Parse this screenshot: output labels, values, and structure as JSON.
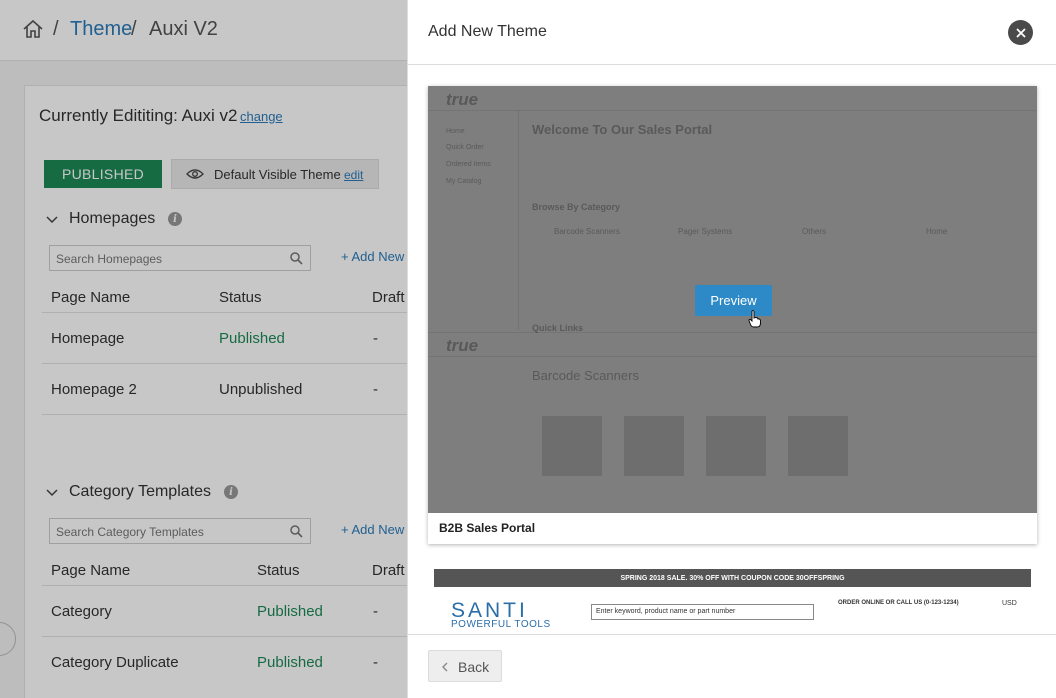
{
  "breadcrumb": {
    "theme": "Theme",
    "sep": "/",
    "current": "Auxi V2"
  },
  "editing": {
    "title": "Currently Edititing: Auxi v2",
    "change": "change"
  },
  "status": {
    "published": "PUBLISHED",
    "visible": "Default Visible Theme",
    "edit": "edit"
  },
  "homepages": {
    "title": "Homepages",
    "search_placeholder": "Search Homepages",
    "add_new": "+ Add New",
    "columns": [
      "Page Name",
      "Status",
      "Draft"
    ],
    "rows": [
      {
        "name": "Homepage",
        "status": "Published",
        "draft": "-"
      },
      {
        "name": "Homepage 2",
        "status": "Unpublished",
        "draft": "-"
      }
    ]
  },
  "category_templates": {
    "title": "Category Templates",
    "search_placeholder": "Search Category Templates",
    "add_new": "+ Add New",
    "columns": [
      "Page Name",
      "Status",
      "Draft"
    ],
    "rows": [
      {
        "name": "Category",
        "status": "Published",
        "draft": "-"
      },
      {
        "name": "Category Duplicate",
        "status": "Published",
        "draft": "-"
      }
    ]
  },
  "drawer": {
    "title": "Add New Theme",
    "back": "Back",
    "preview": "Preview",
    "themes": [
      {
        "name": "B2B Sales Portal"
      }
    ],
    "thumb1": {
      "welcome": "Welcome To Our Sales Portal",
      "browse": "Browse By Category",
      "quick_links": "Quick Links",
      "barcode": "Barcode Scanners",
      "nav": [
        "Home",
        "Quick Order",
        "Ordered Items",
        "My Catalog"
      ],
      "cats": [
        "Barcode Scanners",
        "Pager Systems",
        "Others",
        "Home"
      ]
    },
    "thumb2": {
      "promo": "SPRING 2018 SALE. 30% OFF WITH COUPON CODE 30OFFSPRING",
      "logo": "SANTI",
      "tagline": "POWERFUL TOOLS",
      "search_placeholder": "Enter keyword, product name or part number",
      "order": "ORDER ONLINE OR CALL US (0-123-1234)",
      "currency": "USD"
    }
  },
  "colors": {
    "link": "#2b7bb9",
    "published": "#1e8a57",
    "preview": "#2e8ac6"
  }
}
